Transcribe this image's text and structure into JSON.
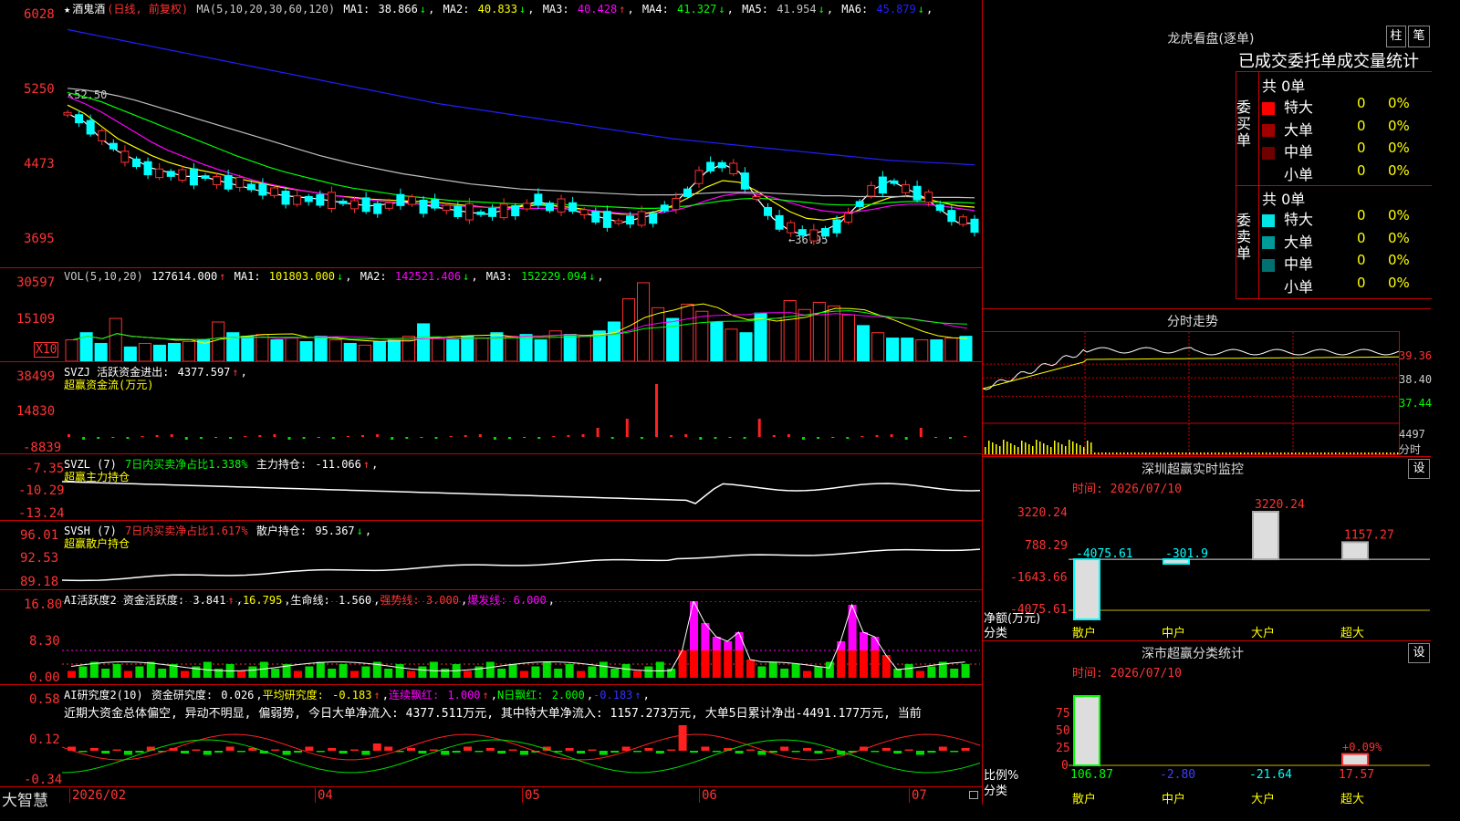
{
  "stock": {
    "star": "★",
    "name": "酒鬼酒",
    "period": "(日线, 前复权)",
    "ma_params": "MA(5,10,20,30,60,120)",
    "ma": [
      {
        "label": "MA1:",
        "value": "38.866",
        "arrow": "↓",
        "color": "#ffffff"
      },
      {
        "label": "MA2:",
        "value": "40.833",
        "arrow": "↓",
        "color": "#ffff00"
      },
      {
        "label": "MA3:",
        "value": "40.428",
        "arrow": "↑",
        "color": "#ff00ff"
      },
      {
        "label": "MA4:",
        "value": "41.327",
        "arrow": "↓",
        "color": "#00ff00"
      },
      {
        "label": "MA5:",
        "value": "41.954",
        "arrow": "↓",
        "color": "#c0c0c0"
      },
      {
        "label": "MA6:",
        "value": "45.879",
        "arrow": "↓",
        "color": "#2020ff"
      }
    ],
    "y_labels": [
      "6028",
      "5250",
      "4473",
      "3695"
    ],
    "high_mark": "52.50",
    "low_mark": "←36.95"
  },
  "vol": {
    "params": "VOL(5,10,20)",
    "value": "127614.000",
    "arrow": "↑",
    "ma": [
      {
        "label": "MA1:",
        "value": "101803.000",
        "arrow": "↓",
        "color": "#ffff00"
      },
      {
        "label": "MA2:",
        "value": "142521.406",
        "arrow": "↓",
        "color": "#ff00ff"
      },
      {
        "label": "MA3:",
        "value": "152229.094",
        "arrow": "↓",
        "color": "#00ff00"
      }
    ],
    "y_labels": [
      "30597",
      "15109"
    ],
    "unit": "X10"
  },
  "svzj": {
    "label": "SVZJ  活跃资金进出:",
    "value": "4377.597",
    "arrow": "↑",
    "comma": ",",
    "subtitle": "超赢资金流(万元)",
    "y_labels": [
      "38499",
      "14830",
      "-8839"
    ]
  },
  "svzl": {
    "label": "SVZL (7)",
    "desc": "7日内买卖净占比1.338%",
    "hold_label": "主力持仓:",
    "hold": "-11.066",
    "arrow": "↑",
    "comma": ",",
    "subtitle": "超赢主力持仓",
    "y_labels": [
      "-7.35",
      "-10.29",
      "-13.24"
    ]
  },
  "svsh": {
    "label": "SVSH (7)",
    "desc": "7日内买卖净占比1.617%",
    "hold_label": "散户持仓:",
    "hold": "95.367",
    "arrow": "↓",
    "comma": ",",
    "subtitle": "超赢散户持仓",
    "y_labels": [
      "96.01",
      "92.53",
      "89.18"
    ]
  },
  "ai_active": {
    "label": "AI活跃度2 资金活跃度:",
    "value": "3.841",
    "arrow": "↑",
    "v2": "16.795",
    "life_label": "生命线:",
    "life": "1.560",
    "strong": "强势线: 3.000",
    "burst": "爆发线: 6.000",
    "y_labels": [
      "16.80",
      "8.30",
      "0.00"
    ]
  },
  "ai_research": {
    "label": "AI研究度2(10)",
    "fund_label": "资金研究度:",
    "fund": "0.026",
    "avg_label": "平均研究度:",
    "avg": "-0.183",
    "red_label": "连续飘红:",
    "red": "1.000",
    "nred_label": "N日飘红:",
    "nred": "2.000",
    "last": "-0.183",
    "comment": "近期大资金总体偏空, 异动不明显, 偏弱势, 今日大单净流入: 4377.511万元, 其中特大单净流入: 1157.273万元, 大单5日累计净出-4491.177万元, 当前",
    "y_labels": [
      "0.58",
      "0.12",
      "-0.34"
    ]
  },
  "date_axis": [
    "2026/02",
    "04",
    "05",
    "06",
    "07"
  ],
  "brand": "大智慧",
  "chart_data": [
    {
      "type": "line",
      "title": "酒鬼酒 (日线, 前复权)",
      "ylabel": "",
      "series": [
        {
          "name": "MA1",
          "values": [
            52.0,
            51.0,
            49.0,
            47.5,
            46.5,
            45.5,
            45.0,
            44.5,
            44.5,
            44.0,
            43.5,
            43.0,
            42.5,
            42.2,
            42.0,
            41.8,
            41.5,
            41.2,
            41.0,
            41.2,
            41.5,
            41.2,
            40.8,
            40.5,
            40.2,
            40.0,
            40.5,
            41.0,
            41.5,
            41.0,
            40.5,
            40.0,
            39.5,
            39.0,
            39.5,
            40.0,
            41.0,
            43.0,
            45.0,
            46.0,
            45.0,
            42.0,
            39.5,
            38.0,
            37.5,
            38.0,
            39.0,
            41.0,
            43.0,
            44.0,
            43.0,
            42.0,
            40.5,
            39.0,
            38.866
          ]
        },
        {
          "name": "MA2",
          "values": [
            53.0,
            52.0,
            50.5,
            49.0,
            48.0,
            47.0,
            46.2,
            45.6,
            45.2,
            44.8,
            44.3,
            43.9,
            43.5,
            43.1,
            42.8,
            42.5,
            42.2,
            42.0,
            41.8,
            41.7,
            41.6,
            41.5,
            41.4,
            41.2,
            41.0,
            40.8,
            40.8,
            40.9,
            41.1,
            41.0,
            40.8,
            40.5,
            40.2,
            40.0,
            40.0,
            40.3,
            41.0,
            42.0,
            43.2,
            44.0,
            43.8,
            42.8,
            41.5,
            40.3,
            39.5,
            39.3,
            39.6,
            40.4,
            41.3,
            42.0,
            42.2,
            41.9,
            41.4,
            41.0,
            40.833
          ]
        },
        {
          "name": "MA3",
          "values": [
            54.0,
            53.2,
            52.2,
            51.0,
            49.8,
            48.6,
            47.6,
            46.8,
            46.0,
            45.3,
            44.7,
            44.1,
            43.6,
            43.2,
            42.8,
            42.5,
            42.2,
            41.9,
            41.7,
            41.5,
            41.3,
            41.2,
            41.1,
            41.0,
            40.9,
            40.8,
            40.7,
            40.7,
            40.7,
            40.7,
            40.6,
            40.5,
            40.3,
            40.1,
            40.0,
            40.1,
            40.4,
            40.9,
            41.6,
            42.2,
            42.5,
            42.4,
            42.0,
            41.4,
            40.8,
            40.4,
            40.2,
            40.3,
            40.6,
            41.0,
            41.2,
            41.2,
            41.0,
            40.7,
            40.428
          ]
        },
        {
          "name": "MA4",
          "values": [
            54.5,
            54.0,
            53.4,
            52.6,
            51.8,
            51.0,
            50.2,
            49.4,
            48.6,
            47.8,
            47.0,
            46.3,
            45.6,
            45.0,
            44.5,
            44.0,
            43.5,
            43.1,
            42.8,
            42.5,
            42.2,
            42.0,
            41.8,
            41.6,
            41.5,
            41.4,
            41.3,
            41.2,
            41.2,
            41.2,
            41.1,
            41.0,
            40.9,
            40.8,
            40.7,
            40.7,
            40.8,
            41.0,
            41.3,
            41.6,
            41.8,
            41.9,
            41.8,
            41.6,
            41.4,
            41.2,
            41.1,
            41.1,
            41.2,
            41.4,
            41.5,
            41.5,
            41.4,
            41.4,
            41.327
          ]
        },
        {
          "name": "MA5",
          "values": [
            55.0,
            54.8,
            54.5,
            54.1,
            53.6,
            53.0,
            52.4,
            51.8,
            51.2,
            50.6,
            50.0,
            49.4,
            48.8,
            48.2,
            47.6,
            47.0,
            46.5,
            46.0,
            45.6,
            45.2,
            44.8,
            44.5,
            44.2,
            43.9,
            43.6,
            43.4,
            43.2,
            43.0,
            42.9,
            42.8,
            42.7,
            42.6,
            42.5,
            42.4,
            42.3,
            42.3,
            42.3,
            42.4,
            42.5,
            42.6,
            42.6,
            42.6,
            42.5,
            42.4,
            42.3,
            42.2,
            42.2,
            42.1,
            42.1,
            42.1,
            42.1,
            42.0,
            42.0,
            42.0,
            41.954
          ]
        },
        {
          "name": "MA6",
          "values": [
            62.0,
            61.6,
            61.2,
            60.8,
            60.4,
            60.0,
            59.6,
            59.2,
            58.8,
            58.4,
            58.0,
            57.6,
            57.2,
            56.8,
            56.4,
            56.0,
            55.6,
            55.2,
            54.8,
            54.4,
            54.0,
            53.6,
            53.2,
            52.9,
            52.6,
            52.3,
            52.0,
            51.7,
            51.4,
            51.1,
            50.8,
            50.5,
            50.2,
            49.9,
            49.6,
            49.3,
            49.0,
            48.8,
            48.6,
            48.4,
            48.2,
            48.0,
            47.8,
            47.6,
            47.4,
            47.2,
            47.0,
            46.8,
            46.6,
            46.4,
            46.3,
            46.2,
            46.1,
            46.0,
            45.879
          ]
        }
      ]
    },
    {
      "type": "bar",
      "title": "VOL(5,10,20)",
      "series": [
        {
          "name": "VOL",
          "values": [
            12,
            16,
            10,
            24,
            8,
            10,
            9,
            10,
            11,
            12,
            22,
            16,
            14,
            15,
            12,
            13,
            11,
            14,
            12,
            10,
            9,
            11,
            12,
            14,
            21,
            13,
            12,
            14,
            13,
            16,
            14,
            15,
            12,
            17,
            15,
            14,
            17,
            22,
            35,
            44,
            30,
            24,
            32,
            28,
            22,
            18,
            16,
            27,
            24,
            34,
            29,
            33,
            31,
            26,
            20,
            16,
            13,
            13,
            12,
            12,
            13,
            14
          ]
        }
      ]
    }
  ],
  "right": {
    "dragon_title": "龙虎看盘(逐单)",
    "btn_zhu": "柱",
    "btn_bi": "笔",
    "table_title": "已成交委托单成交量统计",
    "buy_side": "委买单",
    "sell_side": "委卖单",
    "buy_total": "共 0单",
    "sell_total": "共 0单",
    "buy_rows": [
      {
        "label": "特大",
        "color": "#ff0000",
        "count": "0",
        "pct": "0%"
      },
      {
        "label": "大单",
        "color": "#a00000",
        "count": "0",
        "pct": "0%"
      },
      {
        "label": "中单",
        "color": "#700000",
        "count": "0",
        "pct": "0%"
      },
      {
        "label": "小单",
        "color": "",
        "count": "0",
        "pct": "0%"
      }
    ],
    "sell_rows": [
      {
        "label": "特大",
        "color": "#00e5e5",
        "count": "0",
        "pct": "0%"
      },
      {
        "label": "大单",
        "color": "#009999",
        "count": "0",
        "pct": "0%"
      },
      {
        "label": "中单",
        "color": "#007070",
        "count": "0",
        "pct": "0%"
      },
      {
        "label": "小单",
        "color": "",
        "count": "0",
        "pct": "0%"
      }
    ],
    "intraday_title": "分时走势",
    "intraday_y": [
      "39.36",
      "38.40",
      "37.44"
    ],
    "intraday_vol": "4497",
    "intraday_vol_unit": "分时",
    "sz_monitor_title": "深圳超赢实时监控",
    "btn_set": "设",
    "date_line": "时间: 2026/07/10",
    "monitor_y": [
      "3220.24",
      "788.29",
      "-1643.66",
      "-4075.61"
    ],
    "monitor_values": [
      "-4075.61",
      "-301.9",
      "3220.24",
      "1157.27"
    ],
    "monitor_ylabel": "净额(万元)",
    "monitor_xlabel": "分类",
    "categories": [
      "散户",
      "中户",
      "大户",
      "超大"
    ],
    "category_stats_title": "深市超赢分类统计",
    "stats_y": [
      "75",
      "50",
      "25",
      "0"
    ],
    "stats_values": [
      "106.87",
      "-2.80",
      "-21.64",
      "17.57"
    ],
    "stats_small": "+0.09%",
    "stats_ylabel": "比例%",
    "stats_xlabel": "分类"
  }
}
